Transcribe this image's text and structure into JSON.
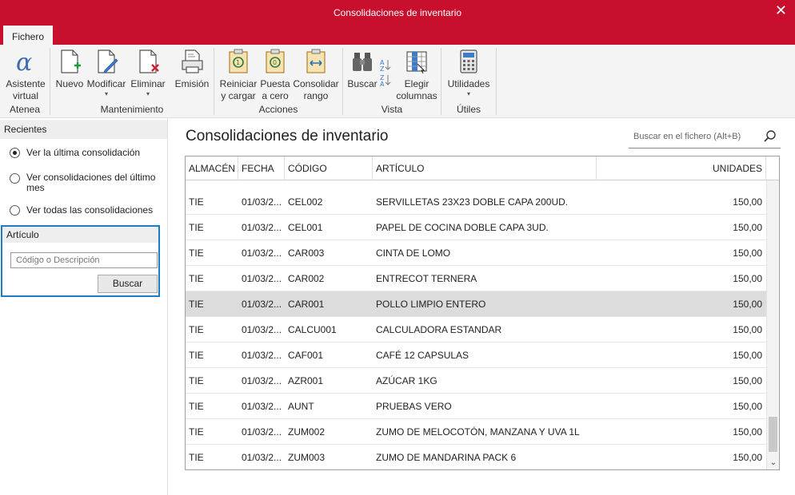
{
  "window": {
    "title": "Consolidaciones de inventario",
    "close_glyph": "✕"
  },
  "menu": {
    "active_tab": "Fichero"
  },
  "ribbon": {
    "groups": [
      {
        "label": "Atenea",
        "buttons": [
          {
            "line1": "Asistente",
            "line2": "virtual",
            "icon": "alpha-assistant-icon"
          }
        ]
      },
      {
        "label": "Mantenimiento",
        "buttons": [
          {
            "line1": "Nuevo",
            "icon": "new-document-icon"
          },
          {
            "line1": "Modificar",
            "icon": "edit-document-icon",
            "dropdown": "▾"
          },
          {
            "line1": "Eliminar",
            "icon": "delete-document-icon",
            "dropdown": "▾"
          },
          {
            "line1": "Emisión",
            "icon": "print-icon"
          }
        ]
      },
      {
        "label": "Acciones",
        "buttons": [
          {
            "line1": "Reiniciar",
            "line2": "y cargar",
            "icon": "reset-load-icon"
          },
          {
            "line1": "Puesta",
            "line2": "a cero",
            "icon": "zero-icon"
          },
          {
            "line1": "Consolidar",
            "line2": "rango",
            "icon": "consolidate-range-icon"
          }
        ]
      },
      {
        "label": "Vista",
        "buttons": [
          {
            "line1": "Buscar",
            "icon": "binoculars-icon"
          },
          {
            "line1": "Elegir",
            "line2": "columnas",
            "icon": "columns-icon"
          }
        ]
      },
      {
        "label": "Útiles",
        "buttons": [
          {
            "line1": "Utilidades",
            "icon": "calculator-icon",
            "dropdown": "▾"
          }
        ]
      }
    ]
  },
  "left_pane": {
    "recent_header": "Recientes",
    "options": [
      {
        "label": "Ver la última consolidación",
        "selected": true
      },
      {
        "label": "Ver consolidaciones del último mes",
        "selected": false
      },
      {
        "label": "Ver todas las consolidaciones",
        "selected": false
      }
    ],
    "article_header": "Artículo",
    "article_placeholder": "Código o Descripción",
    "search_button": "Buscar"
  },
  "main": {
    "title": "Consolidaciones de inventario",
    "search_placeholder": "Buscar en el fichero (Alt+B)"
  },
  "table": {
    "columns": [
      "ALMACÉN",
      "FECHA",
      "CÓDIGO",
      "ARTÍCULO",
      "UNIDADES"
    ],
    "rows": [
      [
        "TIE",
        "01/03/2...",
        "CEL002",
        "SERVILLETAS 23X23 DOBLE CAPA 200UD.",
        "150,00"
      ],
      [
        "TIE",
        "01/03/2...",
        "CEL001",
        "PAPEL DE COCINA DOBLE CAPA 3UD.",
        "150,00"
      ],
      [
        "TIE",
        "01/03/2...",
        "CAR003",
        "CINTA DE LOMO",
        "150,00"
      ],
      [
        "TIE",
        "01/03/2...",
        "CAR002",
        "ENTRECOT TERNERA",
        "150,00"
      ],
      [
        "TIE",
        "01/03/2...",
        "CAR001",
        "POLLO LIMPIO ENTERO",
        "150,00"
      ],
      [
        "TIE",
        "01/03/2...",
        "CALCU001",
        "CALCULADORA ESTANDAR",
        "150,00"
      ],
      [
        "TIE",
        "01/03/2...",
        "CAF001",
        "CAFÉ 12 CAPSULAS",
        "150,00"
      ],
      [
        "TIE",
        "01/03/2...",
        "AZR001",
        "AZÚCAR 1KG",
        "150,00"
      ],
      [
        "TIE",
        "01/03/2...",
        "AUNT",
        "PRUEBAS VERO",
        "150,00"
      ],
      [
        "TIE",
        "01/03/2...",
        "ZUM002",
        "ZUMO DE MELOCOTÓN, MANZANA Y UVA 1L",
        "150,00"
      ],
      [
        "TIE",
        "01/03/2...",
        "ZUM003",
        "ZUMO DE MANDARINA PACK 6",
        "150,00"
      ]
    ],
    "selected_row": 4
  },
  "colors": {
    "brand": "#c8102e",
    "focus_border": "#1e7bc5",
    "selected_row": "#dcdcdc"
  }
}
